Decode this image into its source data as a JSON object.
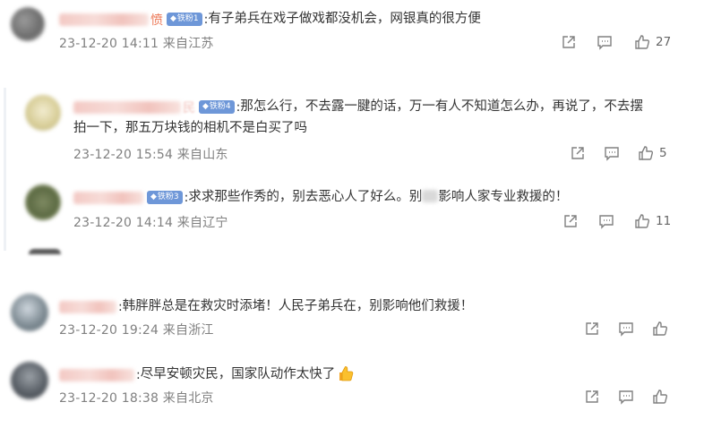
{
  "comments": [
    {
      "name_tail": "愤",
      "badge": "铁粉1",
      "text": "有子弟兵在戏子做戏都没机会，网银真的很方便",
      "time": "23-12-20 14:11 来自江苏",
      "likes": "27"
    },
    {
      "name_tail": "民",
      "badge": "铁粉4",
      "text_line1": "那怎么行，不去露一腱的话，万一有人不知道怎么办，再说了，不去摆",
      "text_line2": "拍一下，那五万块钱的相机不是白买了吗",
      "time": "23-12-20 15:54 来自山东",
      "likes": "5"
    },
    {
      "badge": "铁粉3",
      "text_a": "求求那些作秀的，别去恶心人了好么。别",
      "text_b": "影响人家专业救援的！",
      "time": "23-12-20 14:14 来自辽宁",
      "likes": "11"
    },
    {
      "text": "韩胖胖总是在救灾时添堵！人民子弟兵在，别影响他们救援！",
      "time": "23-12-20 19:24 来自浙江"
    },
    {
      "text": "尽早安顿灾民，国家队动作太快了",
      "time": "23-12-20 18:38 来自北京"
    }
  ],
  "colors": {
    "name": "#eb7350",
    "badge": "#6e97d8",
    "meta": "#808080",
    "text": "#333333"
  },
  "icons": [
    "share-icon",
    "comment-icon",
    "like-icon",
    "thumbs-up-emoji"
  ]
}
